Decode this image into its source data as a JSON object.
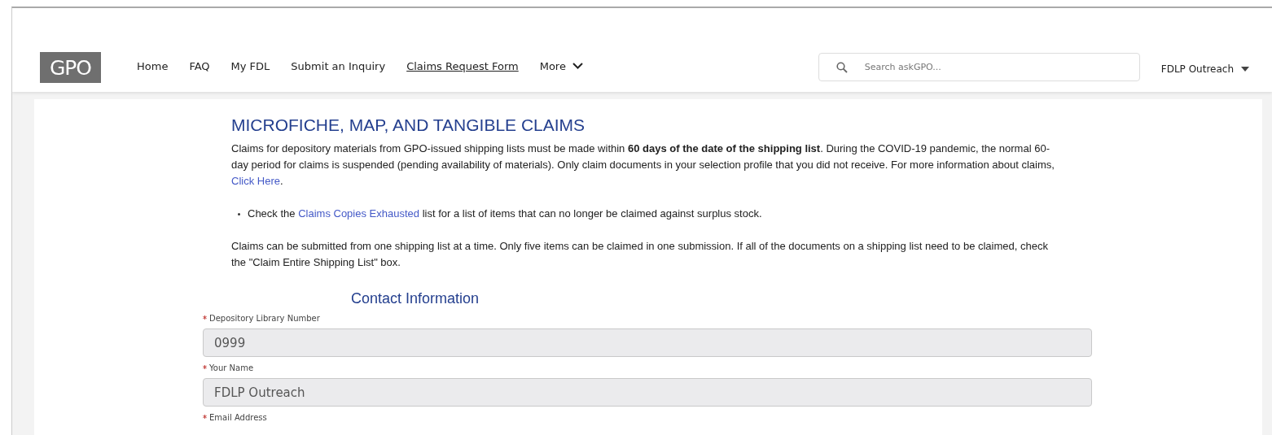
{
  "header": {
    "logo": "GPO",
    "nav": [
      {
        "label": "Home",
        "selected": false
      },
      {
        "label": "FAQ",
        "selected": false
      },
      {
        "label": "My FDL",
        "selected": false
      },
      {
        "label": "Submit an Inquiry",
        "selected": false
      },
      {
        "label": "Claims Request Form",
        "selected": true
      },
      {
        "label": "More",
        "selected": false,
        "kind": "menu"
      }
    ],
    "search": {
      "placeholder": "Search askGPO..."
    },
    "user_menu": "FDLP Outreach"
  },
  "page": {
    "title": "MICROFICHE, MAP, AND TANGIBLE CLAIMS",
    "paragraphs": [
      {
        "kind": "paragraph",
        "text": "Claims for depository materials from GPO-issued shipping lists must be made within **60 days of the date of the shipping list**. During the COVID-19 pandemic, the normal 60-day period for claims is suspended (pending availability of materials). Only claim documents in your selection profile that you did not receive. For more information about claims, ",
        "link": "Click Here",
        "after": "."
      },
      {
        "kind": "bullet",
        "text": "Check the ",
        "link": "Claims Copies Exhausted",
        "after": " list for a list of items that can no longer be claimed against surplus stock."
      },
      {
        "kind": "paragraph",
        "text": "Claims can be submitted from one shipping list at a time. Only five items can be claimed in one submission. If all of the documents on a shipping list need to be claimed, check the \"Claim Entire Shipping List\" box."
      }
    ],
    "section_title": "Contact Information",
    "fields": [
      {
        "label": "Depository Library Number",
        "required": true,
        "value": "0999",
        "disabled": true
      },
      {
        "label": "Your Name",
        "required": true,
        "value": "FDLP Outreach",
        "disabled": true
      },
      {
        "label": "Email Address",
        "required": true
      }
    ]
  }
}
